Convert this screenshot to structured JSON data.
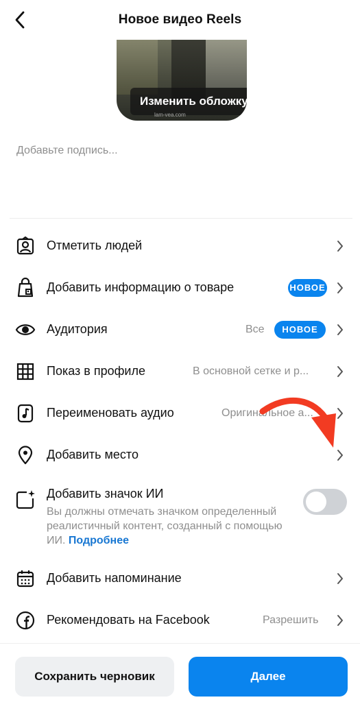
{
  "header": {
    "title": "Новое видео Reels"
  },
  "cover": {
    "edit_label": "Изменить обложку",
    "watermark": "lam-vea.com"
  },
  "caption": {
    "placeholder": "Добавьте подпись..."
  },
  "options": [
    {
      "label": "Отметить людей",
      "icon": "tag-people-icon"
    },
    {
      "label": "Добавить информацию о товаре",
      "badge": "НОВОЕ",
      "icon": "product-tag-icon"
    },
    {
      "label": "Аудитория",
      "value": "Все",
      "badge": "НОВОЕ",
      "icon": "audience-icon"
    },
    {
      "label": "Показ в профиле",
      "value": "В основной сетке и р...",
      "icon": "grid-icon"
    },
    {
      "label": "Переименовать аудио",
      "value": "Оригинальное а...",
      "icon": "audio-icon"
    },
    {
      "label": "Добавить место",
      "icon": "location-pin-icon"
    },
    {
      "label": "Добавить напоминание",
      "icon": "calendar-icon"
    },
    {
      "label": "Рекомендовать на Facebook",
      "value": "Разрешить",
      "icon": "facebook-icon"
    }
  ],
  "ai_label": {
    "title": "Добавить значок ИИ",
    "description": "Вы должны отмечать значком определенный реалистичный контент, созданный с помощью ИИ.",
    "link": "Подробнее",
    "enabled": false
  },
  "footer": {
    "draft_button": "Сохранить черновик",
    "next_button": "Далее"
  },
  "colors": {
    "accent": "#0a84ee",
    "annotation_arrow": "#f23b22",
    "muted_text": "#8e8e8e"
  }
}
